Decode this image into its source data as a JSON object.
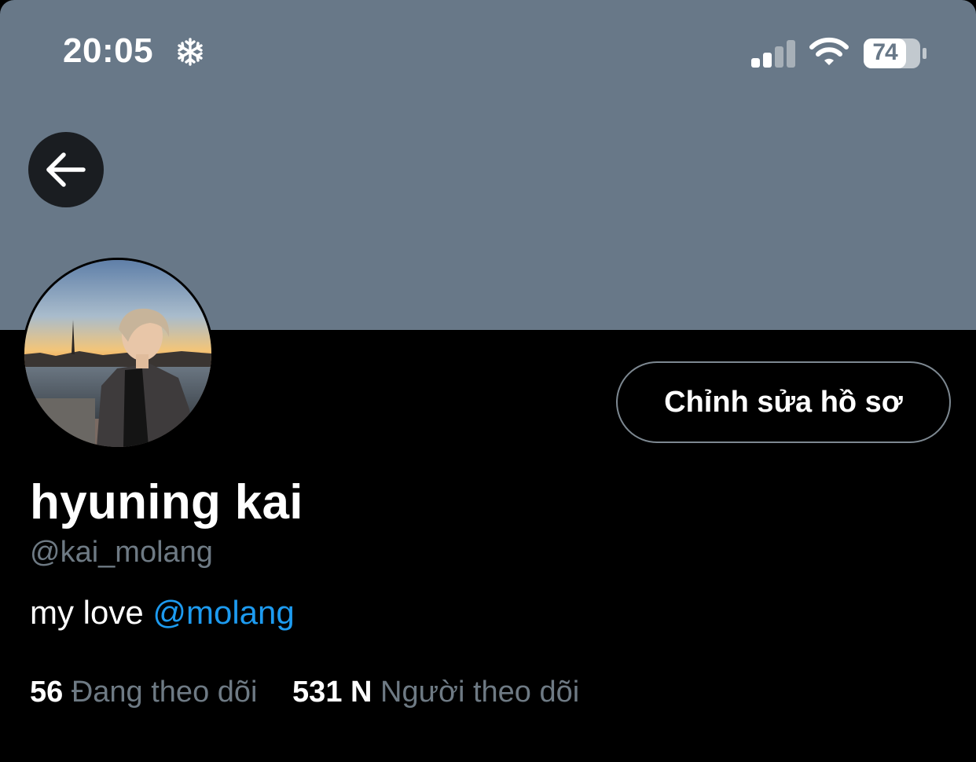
{
  "status_bar": {
    "time": "20:05",
    "battery_level": "74",
    "signal_bars_active": 2,
    "signal_bars_total": 4
  },
  "profile": {
    "edit_button_label": "Chỉnh sửa hồ sơ",
    "display_name": "hyuning kai",
    "handle": "@kai_molang",
    "bio_text": "my love ",
    "bio_mention": "@molang",
    "following_count": "56",
    "following_label": "Đang theo dõi",
    "followers_count": "531 N",
    "followers_label": "Người theo dõi"
  },
  "icons": {
    "back": "arrow-left-icon",
    "status_extra": "snowflake-icon",
    "signal": "cellular-signal-icon",
    "wifi": "wifi-icon",
    "battery": "battery-icon"
  },
  "colors": {
    "banner": "#687888",
    "background": "#000000",
    "mention": "#1d9bf0",
    "secondary_text": "#6e7a84"
  }
}
